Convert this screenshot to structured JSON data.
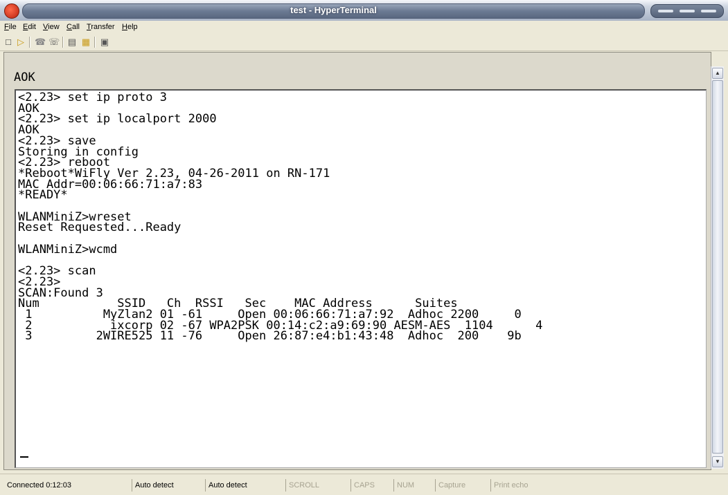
{
  "window": {
    "title": "test - HyperTerminal"
  },
  "menu": [
    "File",
    "Edit",
    "View",
    "Call",
    "Transfer",
    "Help"
  ],
  "toolbar": {
    "icons": [
      "new-connection-icon",
      "open-icon",
      "connect-icon",
      "disconnect-icon",
      "send-icon",
      "receive-icon",
      "properties-icon"
    ]
  },
  "terminal": {
    "echo": "AOK",
    "text": "<2.23> set ip proto 3\nAOK\n<2.23> set ip localport 2000\nAOK\n<2.23> save\nStoring in config\n<2.23> reboot\n*Reboot*WiFly Ver 2.23, 04-26-2011 on RN-171\nMAC Addr=00:06:66:71:a7:83\n*READY*\n\nWLANMiniZ>wreset\nReset Requested...Ready\n\nWLANMiniZ>wcmd\n\n<2.23> scan\n<2.23>\nSCAN:Found 3\nNum           SSID   Ch  RSSI   Sec    MAC Address      Suites\n 1          MyZlan2 01 -61     Open 00:06:66:71:a7:92  Adhoc 2200     0\n 2           ixcorp 02 -67 WPA2PSK 00:14:c2:a9:69:90 AESM-AES  1104      4\n 3         2WIRE525 11 -76     Open 26:87:e4:b1:43:48  Adhoc  200    9b"
  },
  "status": {
    "connected": "Connected 0:12:03",
    "detect1": "Auto detect",
    "detect2": "Auto detect",
    "scroll": "SCROLL",
    "caps": "CAPS",
    "num": "NUM",
    "capture": "Capture",
    "print_echo": "Print echo"
  }
}
